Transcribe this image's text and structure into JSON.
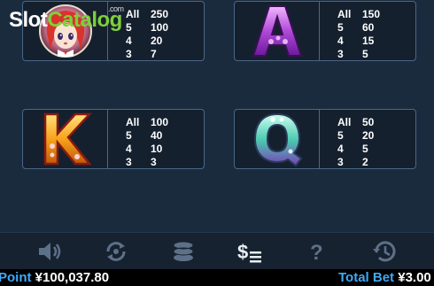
{
  "brand": {
    "slot": "Slot",
    "catalog": "Catalog",
    "com": ".com"
  },
  "paytable": [
    {
      "symbol": "anime-girl",
      "rows": [
        [
          "All",
          "250"
        ],
        [
          "5",
          "100"
        ],
        [
          "4",
          "20"
        ],
        [
          "3",
          "7"
        ]
      ]
    },
    {
      "symbol": "A",
      "rows": [
        [
          "All",
          "150"
        ],
        [
          "5",
          "60"
        ],
        [
          "4",
          "15"
        ],
        [
          "3",
          "5"
        ]
      ]
    },
    {
      "symbol": "K",
      "rows": [
        [
          "All",
          "100"
        ],
        [
          "5",
          "40"
        ],
        [
          "4",
          "10"
        ],
        [
          "3",
          "3"
        ]
      ]
    },
    {
      "symbol": "Q",
      "rows": [
        [
          "All",
          "50"
        ],
        [
          "5",
          "20"
        ],
        [
          "4",
          "5"
        ],
        [
          "3",
          "2"
        ]
      ]
    }
  ],
  "toolbar": {
    "icons": [
      "sound-icon",
      "autoplay-icon",
      "chips-icon",
      "paytable-icon",
      "help-icon",
      "history-icon"
    ]
  },
  "status": {
    "point_label": "Point",
    "point_value": "¥100,037.80",
    "bet_label": "Total Bet",
    "bet_value": "¥3.00"
  },
  "colors": {
    "accent_blue": "#3fa9f5",
    "brand_green": "#7ed03a",
    "card_border": "#4a6786"
  }
}
